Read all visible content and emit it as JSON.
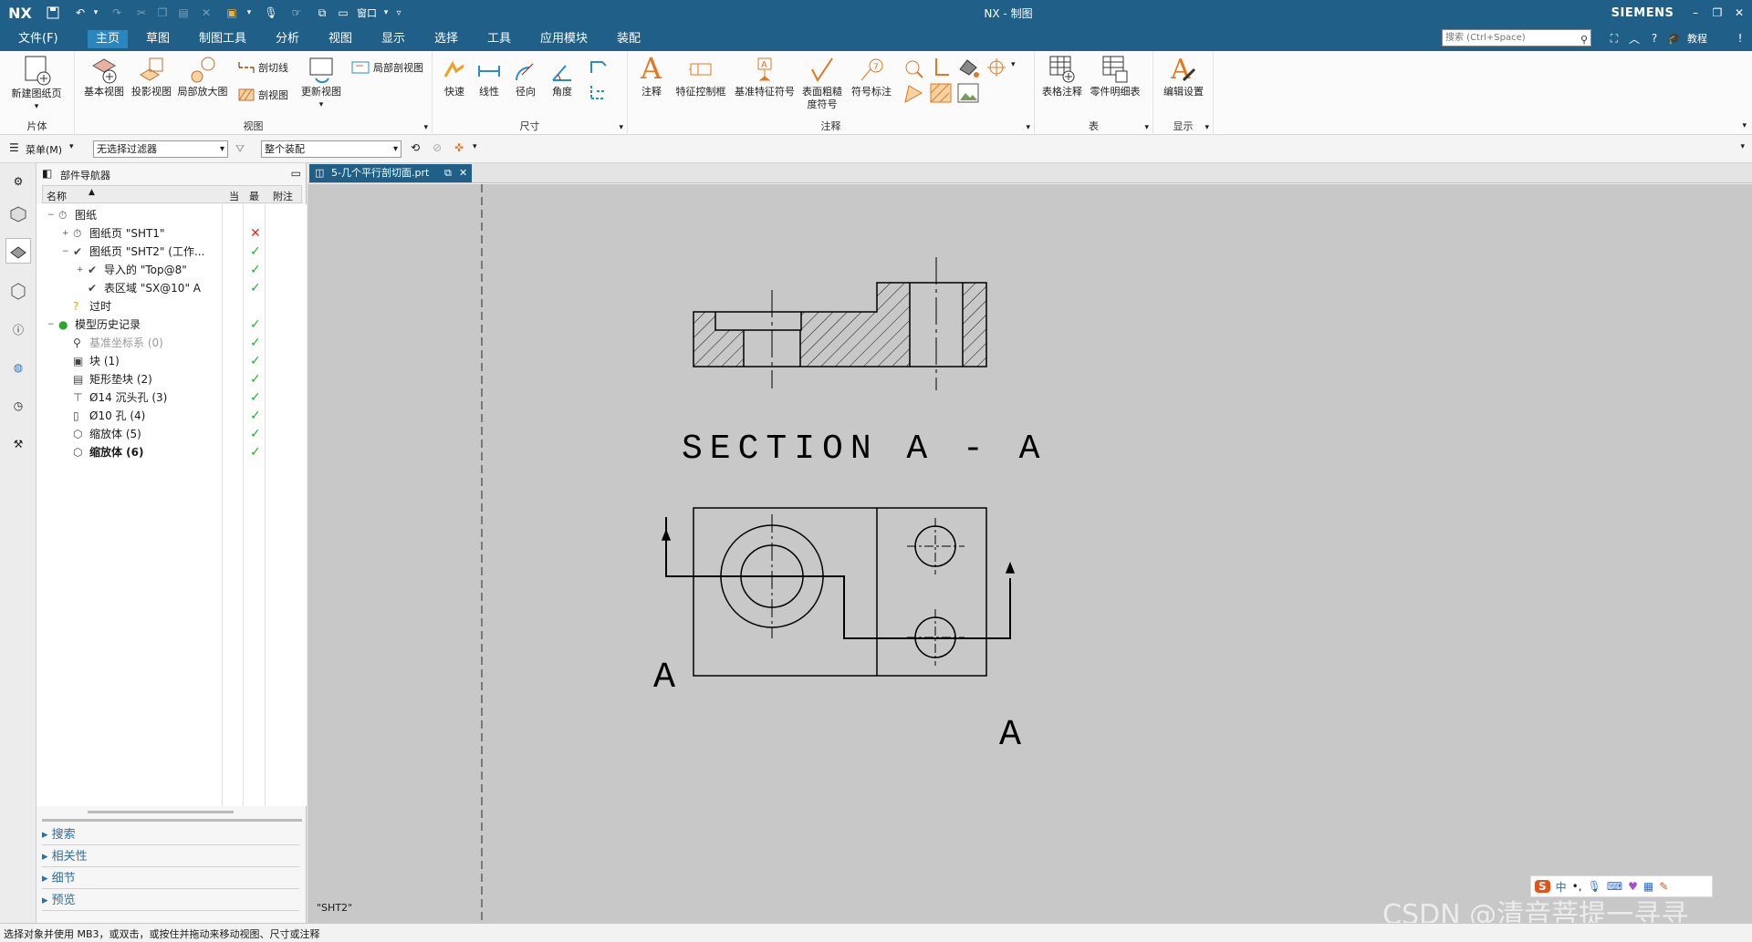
{
  "title_bar": {
    "logo": "NX",
    "title": "NX - 制图",
    "brand": "SIEMENS",
    "window_menu": "窗口"
  },
  "menu": {
    "items": [
      "文件(F)",
      "主页",
      "草图",
      "制图工具",
      "分析",
      "视图",
      "显示",
      "选择",
      "工具",
      "应用模块",
      "装配"
    ],
    "active": "主页",
    "search_placeholder": "搜索 (Ctrl+Space)",
    "tutorial": "教程"
  },
  "ribbon": {
    "groups": {
      "sheet": "片体",
      "view": "视图",
      "dimension": "尺寸",
      "annotation": "注释",
      "table": "表",
      "display": "显示"
    },
    "tools": {
      "new_sheet": "新建图纸页",
      "base_view": "基本视图",
      "projected_view": "投影视图",
      "detail_view": "局部放大图",
      "section_line": "剖切线",
      "section_view": "剖视图",
      "update_view": "更新视图",
      "break_out_section": "局部剖视图",
      "rapid": "快速",
      "linear": "线性",
      "radial": "径向",
      "angular": "角度",
      "note": "注释",
      "fcf": "特征控制框",
      "datum_feature": "基准特征符号",
      "surface_finish": "表面粗糙度符号",
      "symbol_callout": "符号标注",
      "tabular_note": "表格注释",
      "parts_list": "零件明细表",
      "edit_settings": "编辑设置"
    }
  },
  "selbar": {
    "menu": "菜单(M)",
    "filter": "无选择过滤器",
    "scope": "整个装配"
  },
  "navigator": {
    "title": "部件导航器",
    "columns": [
      "名称",
      "当",
      "最",
      "附注"
    ],
    "rows": [
      {
        "indent": 0,
        "text": "图纸",
        "status": ""
      },
      {
        "indent": 1,
        "text": "图纸页 \"SHT1\"",
        "status": "cross"
      },
      {
        "indent": 1,
        "text": "图纸页 \"SHT2\" (工作...",
        "status": "check"
      },
      {
        "indent": 2,
        "text": "导入的 \"Top@8\"",
        "status": "check"
      },
      {
        "indent": 2,
        "text": "表区域 \"SX@10\" A",
        "status": "check"
      },
      {
        "indent": 1,
        "text": "过时",
        "status": ""
      },
      {
        "indent": 0,
        "text": "模型历史记录",
        "status": "check"
      },
      {
        "indent": 1,
        "text": "基准坐标系 (0)",
        "status": "check"
      },
      {
        "indent": 1,
        "text": "块 (1)",
        "status": "check"
      },
      {
        "indent": 1,
        "text": "矩形垫块 (2)",
        "status": "check"
      },
      {
        "indent": 1,
        "text": "Ø14 沉头孔 (3)",
        "status": "check"
      },
      {
        "indent": 1,
        "text": "Ø10 孔 (4)",
        "status": "check"
      },
      {
        "indent": 1,
        "text": "缩放体 (5)",
        "status": "check"
      },
      {
        "indent": 1,
        "text": "缩放体 (6)",
        "status": "check"
      }
    ],
    "panels": [
      "搜索",
      "相关性",
      "细节",
      "预览"
    ]
  },
  "document_tab": {
    "label": "5-几个平行剖切面.prt"
  },
  "drawing": {
    "section_label": "SECTION A - A",
    "arrow_label": "A",
    "sheet_name": "\"SHT2\"",
    "watermark": "CSDN @清音菩提一寻寻"
  },
  "ime": {
    "mode": "中"
  },
  "status": {
    "text": "选择对象并使用 MB3，或双击，或按住并拖动来移动视图、尺寸或注释"
  }
}
